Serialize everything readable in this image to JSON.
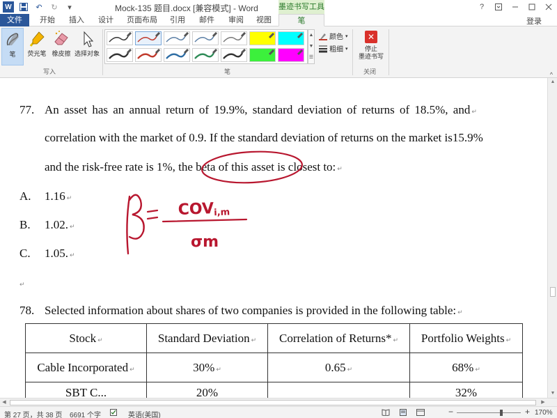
{
  "app": {
    "title": "Mock-135 题目.docx [兼容模式] - Word",
    "context_tab_group": "墨迹书写工具",
    "login": "登录",
    "help_icon": "?"
  },
  "quick_access": [
    {
      "icon": "word-icon",
      "glyph": "W"
    },
    {
      "icon": "save-icon",
      "glyph": "💾"
    },
    {
      "icon": "undo-icon",
      "glyph": "↶"
    },
    {
      "icon": "redo-icon",
      "glyph": "↻"
    },
    {
      "icon": "customize-icon",
      "glyph": "▾"
    }
  ],
  "tabs": [
    {
      "label": "文件",
      "state": "file"
    },
    {
      "label": "开始"
    },
    {
      "label": "插入"
    },
    {
      "label": "设计"
    },
    {
      "label": "页面布局"
    },
    {
      "label": "引用"
    },
    {
      "label": "邮件"
    },
    {
      "label": "审阅"
    },
    {
      "label": "视图"
    },
    {
      "label": "笔",
      "state": "active"
    }
  ],
  "ribbon": {
    "write_group": {
      "label": "写入",
      "tools": [
        {
          "label": "笔",
          "icon": "pen-icon",
          "selected": true
        },
        {
          "label": "荧光笔",
          "icon": "highlighter-icon"
        },
        {
          "label": "橡皮擦",
          "icon": "eraser-icon"
        },
        {
          "label": "选择对象",
          "icon": "select-objects-icon"
        }
      ]
    },
    "pens_group": {
      "label": "笔",
      "pens": [
        {
          "color": "#333333"
        },
        {
          "color": "#c0392b",
          "selected": true
        },
        {
          "color": "#5b7fa5"
        },
        {
          "color": "#5b7fa5"
        },
        {
          "color": "#777777"
        },
        {
          "color": "#ffff00",
          "highlighter": true
        },
        {
          "color": "#00ffff",
          "highlighter": true
        },
        {
          "color": "#333333"
        },
        {
          "color": "#c0392b"
        },
        {
          "color": "#2e6da4"
        },
        {
          "color": "#2e8b57"
        },
        {
          "color": "#333333"
        },
        {
          "color": "#3cf03c",
          "highlighter": true
        },
        {
          "color": "#ff00ff",
          "highlighter": true
        }
      ],
      "color_label": "颜色",
      "thickness_label": "粗细"
    },
    "close_group": {
      "label": "关闭",
      "stop_label_1": "停止",
      "stop_label_2": "墨迹书写"
    }
  },
  "document": {
    "q77": {
      "number": "77.",
      "line1": "An asset has an annual return of 19.9%, standard deviation of returns of 18.5%, and",
      "line2": "correlation with the market of 0.9. If the standard deviation of returns on the market is15.9%",
      "line3": "and the risk-free rate is 1%, the beta of this asset is closest to:",
      "options": [
        {
          "letter": "A.",
          "text": "1.16"
        },
        {
          "letter": "B.",
          "text": "1.02."
        },
        {
          "letter": "C.",
          "text": "1.05."
        }
      ]
    },
    "handwriting": {
      "beta": "β",
      "equals": "=",
      "numerator": "COV",
      "numerator_sub": "i,m",
      "denominator": "σm"
    },
    "q78": {
      "number": "78.",
      "line1": "Selected information about shares of two companies is provided in the following table:",
      "table": {
        "headers": [
          "Stock",
          "Standard Deviation",
          "Correlation of Returns*",
          "Portfolio Weights"
        ],
        "rows": [
          [
            "Cable Incorporated",
            "30%",
            "0.65",
            "68%"
          ],
          [
            "SBT C...",
            "20%",
            "",
            "32%"
          ]
        ]
      }
    }
  },
  "status_bar": {
    "page": "第 27 页，共 38 页",
    "words": "6691 个字",
    "language": "英语(美国)",
    "zoom_out": "−",
    "zoom_in": "+",
    "zoom": "170%",
    "zoom_fraction": 0.7
  }
}
